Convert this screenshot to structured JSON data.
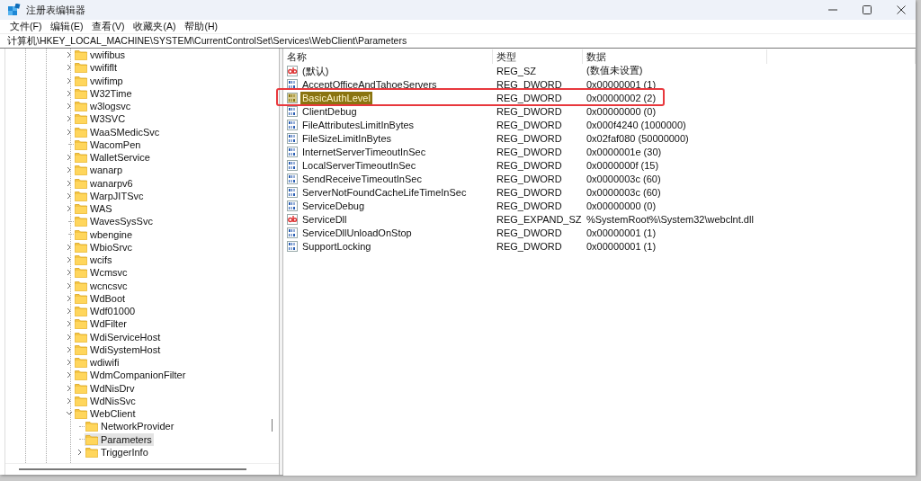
{
  "window": {
    "title": "注册表编辑器"
  },
  "menu": [
    {
      "label": "文件(F)"
    },
    {
      "label": "编辑(E)"
    },
    {
      "label": "查看(V)"
    },
    {
      "label": "收藏夹(A)"
    },
    {
      "label": "帮助(H)"
    }
  ],
  "address": "计算机\\HKEY_LOCAL_MACHINE\\SYSTEM\\CurrentControlSet\\Services\\WebClient\\Parameters",
  "tree": [
    {
      "label": "vwifibus",
      "expandable": true,
      "expanded": false,
      "selected": false
    },
    {
      "label": "vwififlt",
      "expandable": true,
      "expanded": false,
      "selected": false
    },
    {
      "label": "vwifimp",
      "expandable": true,
      "expanded": false,
      "selected": false
    },
    {
      "label": "W32Time",
      "expandable": true,
      "expanded": false,
      "selected": false
    },
    {
      "label": "w3logsvc",
      "expandable": true,
      "expanded": false,
      "selected": false
    },
    {
      "label": "W3SVC",
      "expandable": true,
      "expanded": false,
      "selected": false
    },
    {
      "label": "WaaSMedicSvc",
      "expandable": true,
      "expanded": false,
      "selected": false
    },
    {
      "label": "WacomPen",
      "expandable": false,
      "selected": false
    },
    {
      "label": "WalletService",
      "expandable": true,
      "expanded": false,
      "selected": false
    },
    {
      "label": "wanarp",
      "expandable": true,
      "expanded": false,
      "selected": false
    },
    {
      "label": "wanarpv6",
      "expandable": true,
      "expanded": false,
      "selected": false
    },
    {
      "label": "WarpJITSvc",
      "expandable": true,
      "expanded": false,
      "selected": false
    },
    {
      "label": "WAS",
      "expandable": true,
      "expanded": false,
      "selected": false
    },
    {
      "label": "WavesSysSvc",
      "expandable": false,
      "selected": false
    },
    {
      "label": "wbengine",
      "expandable": false,
      "selected": false
    },
    {
      "label": "WbioSrvc",
      "expandable": true,
      "expanded": false,
      "selected": false
    },
    {
      "label": "wcifs",
      "expandable": true,
      "expanded": false,
      "selected": false
    },
    {
      "label": "Wcmsvc",
      "expandable": true,
      "expanded": false,
      "selected": false
    },
    {
      "label": "wcncsvc",
      "expandable": true,
      "expanded": false,
      "selected": false
    },
    {
      "label": "WdBoot",
      "expandable": true,
      "expanded": false,
      "selected": false
    },
    {
      "label": "Wdf01000",
      "expandable": true,
      "expanded": false,
      "selected": false
    },
    {
      "label": "WdFilter",
      "expandable": true,
      "expanded": false,
      "selected": false
    },
    {
      "label": "WdiServiceHost",
      "expandable": true,
      "expanded": false,
      "selected": false
    },
    {
      "label": "WdiSystemHost",
      "expandable": true,
      "expanded": false,
      "selected": false
    },
    {
      "label": "wdiwifi",
      "expandable": true,
      "expanded": false,
      "selected": false
    },
    {
      "label": "WdmCompanionFilter",
      "expandable": true,
      "expanded": false,
      "selected": false
    },
    {
      "label": "WdNisDrv",
      "expandable": true,
      "expanded": false,
      "selected": false
    },
    {
      "label": "WdNisSvc",
      "expandable": true,
      "expanded": false,
      "selected": false
    },
    {
      "label": "WebClient",
      "expandable": true,
      "expanded": true,
      "selected": false,
      "children": [
        {
          "label": "NetworkProvider",
          "expandable": false,
          "selected": false
        },
        {
          "label": "Parameters",
          "expandable": false,
          "selected": true
        },
        {
          "label": "TriggerInfo",
          "expandable": true,
          "expanded": false,
          "selected": false
        }
      ]
    }
  ],
  "columns": [
    "名称",
    "类型",
    "数据"
  ],
  "values": [
    {
      "kind": "string",
      "name": "(默认)",
      "type": "REG_SZ",
      "data": "(数值未设置)",
      "selected": false,
      "marked": false
    },
    {
      "kind": "binary",
      "name": "AcceptOfficeAndTahoeServers",
      "type": "REG_DWORD",
      "data": "0x00000001 (1)",
      "selected": false,
      "marked": false
    },
    {
      "kind": "binary",
      "name": "BasicAuthLevel",
      "type": "REG_DWORD",
      "data": "0x00000002 (2)",
      "selected": true,
      "marked": true
    },
    {
      "kind": "binary",
      "name": "ClientDebug",
      "type": "REG_DWORD",
      "data": "0x00000000 (0)",
      "selected": false,
      "marked": false
    },
    {
      "kind": "binary",
      "name": "FileAttributesLimitInBytes",
      "type": "REG_DWORD",
      "data": "0x000f4240 (1000000)",
      "selected": false,
      "marked": false
    },
    {
      "kind": "binary",
      "name": "FileSizeLimitInBytes",
      "type": "REG_DWORD",
      "data": "0x02faf080 (50000000)",
      "selected": false,
      "marked": false
    },
    {
      "kind": "binary",
      "name": "InternetServerTimeoutInSec",
      "type": "REG_DWORD",
      "data": "0x0000001e (30)",
      "selected": false,
      "marked": false
    },
    {
      "kind": "binary",
      "name": "LocalServerTimeoutInSec",
      "type": "REG_DWORD",
      "data": "0x0000000f (15)",
      "selected": false,
      "marked": false
    },
    {
      "kind": "binary",
      "name": "SendReceiveTimeoutInSec",
      "type": "REG_DWORD",
      "data": "0x0000003c (60)",
      "selected": false,
      "marked": false
    },
    {
      "kind": "binary",
      "name": "ServerNotFoundCacheLifeTimeInSec",
      "type": "REG_DWORD",
      "data": "0x0000003c (60)",
      "selected": false,
      "marked": false
    },
    {
      "kind": "binary",
      "name": "ServiceDebug",
      "type": "REG_DWORD",
      "data": "0x00000000 (0)",
      "selected": false,
      "marked": false
    },
    {
      "kind": "string",
      "name": "ServiceDll",
      "type": "REG_EXPAND_SZ",
      "data": "%SystemRoot%\\System32\\webclnt.dll",
      "selected": false,
      "marked": false
    },
    {
      "kind": "binary",
      "name": "ServiceDllUnloadOnStop",
      "type": "REG_DWORD",
      "data": "0x00000001 (1)",
      "selected": false,
      "marked": false
    },
    {
      "kind": "binary",
      "name": "SupportLocking",
      "type": "REG_DWORD",
      "data": "0x00000001 (1)",
      "selected": false,
      "marked": false
    }
  ]
}
